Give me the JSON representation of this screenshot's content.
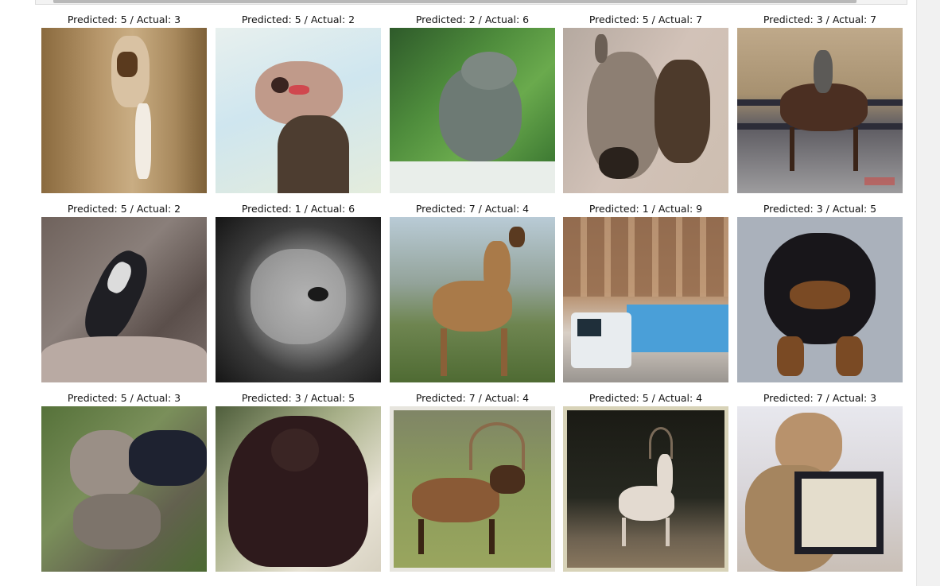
{
  "notebook_output": {
    "predictions": [
      {
        "title": "Predicted: 5 / Actual: 3",
        "thumb": "blurry-cat-portrait"
      },
      {
        "title": "Predicted: 5 / Actual: 2",
        "thumb": "ostrich-head"
      },
      {
        "title": "Predicted: 2 / Actual: 6",
        "thumb": "frog-on-leaves"
      },
      {
        "title": "Predicted: 5 / Actual: 7",
        "thumb": "horse-head"
      },
      {
        "title": "Predicted: 3 / Actual: 7",
        "thumb": "horse-rider"
      },
      {
        "title": "Predicted: 5 / Actual: 2",
        "thumb": "bird-on-rock"
      },
      {
        "title": "Predicted: 1 / Actual: 6",
        "thumb": "gray-frog-closeup"
      },
      {
        "title": "Predicted: 7 / Actual: 4",
        "thumb": "deer-in-field"
      },
      {
        "title": "Predicted: 1 / Actual: 9",
        "thumb": "blue-truck"
      },
      {
        "title": "Predicted: 3 / Actual: 5",
        "thumb": "black-puppy"
      },
      {
        "title": "Predicted: 5 / Actual: 3",
        "thumb": "cat-in-grass"
      },
      {
        "title": "Predicted: 3 / Actual: 5",
        "thumb": "dark-long-haired-dog"
      },
      {
        "title": "Predicted: 7 / Actual: 4",
        "thumb": "elk-on-grass"
      },
      {
        "title": "Predicted: 5 / Actual: 4",
        "thumb": "white-deer-dark-forest"
      },
      {
        "title": "Predicted: 7 / Actual: 3",
        "thumb": "cat-with-picture-frame"
      }
    ]
  }
}
